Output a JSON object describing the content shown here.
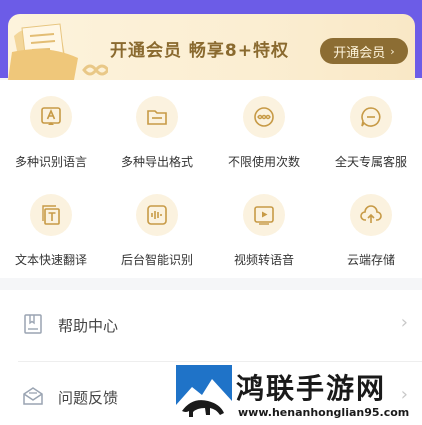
{
  "banner": {
    "title": "开通会员 畅享8+特权",
    "button_label": "开通会员",
    "colors": {
      "background": "#fbeed2",
      "text": "#8a6a2f",
      "button": "#8c6d33",
      "header": "#6c5ce7"
    }
  },
  "features": [
    {
      "label": "多种识别语言",
      "icon": "translate-icon"
    },
    {
      "label": "多种导出格式",
      "icon": "folder-icon"
    },
    {
      "label": "不限使用次数",
      "icon": "infinity-icon"
    },
    {
      "label": "全天专属客服",
      "icon": "chat-icon"
    },
    {
      "label": "文本快速翻译",
      "icon": "text-translate-icon"
    },
    {
      "label": "后台智能识别",
      "icon": "audio-wave-icon"
    },
    {
      "label": "视频转语音",
      "icon": "video-play-icon"
    },
    {
      "label": "云端存储",
      "icon": "cloud-upload-icon"
    }
  ],
  "menu": [
    {
      "label": "帮助中心",
      "icon": "help-book-icon"
    },
    {
      "label": "问题反馈",
      "icon": "feedback-mail-icon"
    }
  ],
  "watermark": {
    "title": "鸿联手游网",
    "url": "www.henanhonglian95.com"
  }
}
